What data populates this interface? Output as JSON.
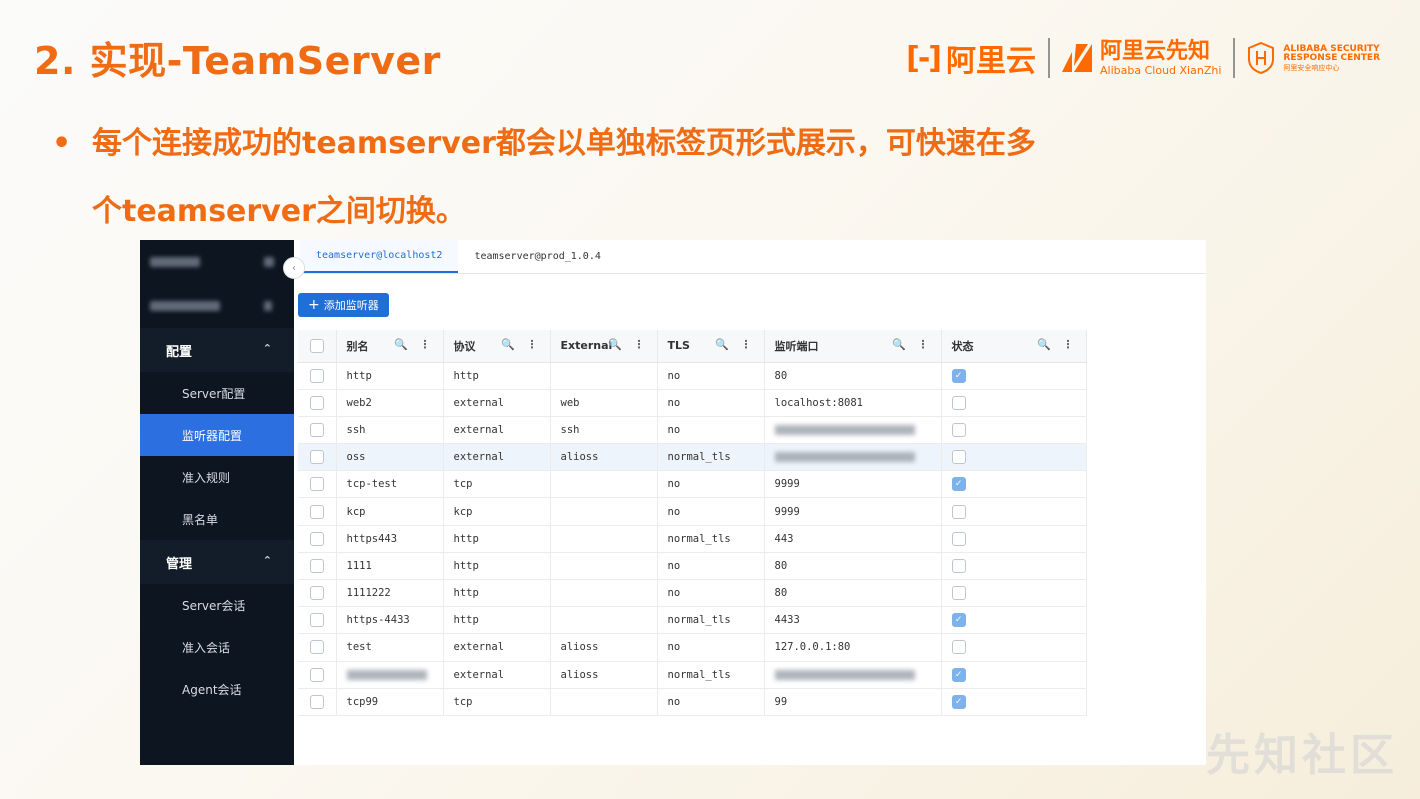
{
  "slide": {
    "title": "2. 实现-TeamServer",
    "bullet_line1": "每个连接成功的teamserver都会以单独标签页形式展示，可快速在多",
    "bullet_line2": "个teamserver之间切换。",
    "bullet_symbol": "•"
  },
  "logos": {
    "aliyun_mark": "[-]",
    "aliyun_text": "阿里云",
    "xianzhi_cn": "阿里云先知",
    "xianzhi_en": "Alibaba Cloud XianZhi",
    "asrc_line1": "ALIBABA SECURITY",
    "asrc_line2": "RESPONSE CENTER",
    "asrc_line3": "阿里安全响应中心"
  },
  "sidebar": {
    "groups": [
      {
        "label": "配置",
        "items": [
          "Server配置",
          "监听器配置",
          "准入规则",
          "黑名单"
        ]
      },
      {
        "label": "管理",
        "items": [
          "Server会话",
          "准入会话",
          "Agent会话"
        ]
      }
    ],
    "active_item": "监听器配置",
    "collapse_icon": "‹"
  },
  "tabs": [
    "teamserver@localhost2",
    "teamserver@prod_1.0.4"
  ],
  "add_button": {
    "icon": "+",
    "label": "添加监听器"
  },
  "table": {
    "headers": [
      "别名",
      "协议",
      "External",
      "TLS",
      "监听端口",
      "状态"
    ],
    "rows": [
      {
        "alias": "http",
        "protocol": "http",
        "external": "",
        "tls": "no",
        "port": "80",
        "status": true
      },
      {
        "alias": "web2",
        "protocol": "external",
        "external": "web",
        "tls": "no",
        "port": "localhost:8081",
        "status": false
      },
      {
        "alias": "ssh",
        "protocol": "external",
        "external": "ssh",
        "tls": "no",
        "port": "",
        "status": false
      },
      {
        "alias": "oss",
        "protocol": "external",
        "external": "alioss",
        "tls": "normal_tls",
        "port": "",
        "status": false
      },
      {
        "alias": "tcp-test",
        "protocol": "tcp",
        "external": "",
        "tls": "no",
        "port": "9999",
        "status": true
      },
      {
        "alias": "kcp",
        "protocol": "kcp",
        "external": "",
        "tls": "no",
        "port": "9999",
        "status": false
      },
      {
        "alias": "https443",
        "protocol": "http",
        "external": "",
        "tls": "normal_tls",
        "port": "443",
        "status": false
      },
      {
        "alias": "1111",
        "protocol": "http",
        "external": "",
        "tls": "no",
        "port": "80",
        "status": false
      },
      {
        "alias": "1111222",
        "protocol": "http",
        "external": "",
        "tls": "no",
        "port": "80",
        "status": false
      },
      {
        "alias": "https-4433",
        "protocol": "http",
        "external": "",
        "tls": "normal_tls",
        "port": "4433",
        "status": true
      },
      {
        "alias": "test",
        "protocol": "external",
        "external": "alioss",
        "tls": "no",
        "port": "127.0.0.1:80",
        "status": false
      },
      {
        "alias": "",
        "protocol": "external",
        "external": "alioss",
        "tls": "normal_tls",
        "port": "",
        "status": true
      },
      {
        "alias": "tcp99",
        "protocol": "tcp",
        "external": "",
        "tls": "no",
        "port": "99",
        "status": true
      }
    ],
    "highlight_row_index": 3,
    "header_icons": "🔍 ⋮"
  },
  "watermark": "先知社区",
  "colors": {
    "accent": "#ef6c14",
    "primary_blue": "#1f6fd6",
    "sidebar_bg": "#0c1520"
  }
}
